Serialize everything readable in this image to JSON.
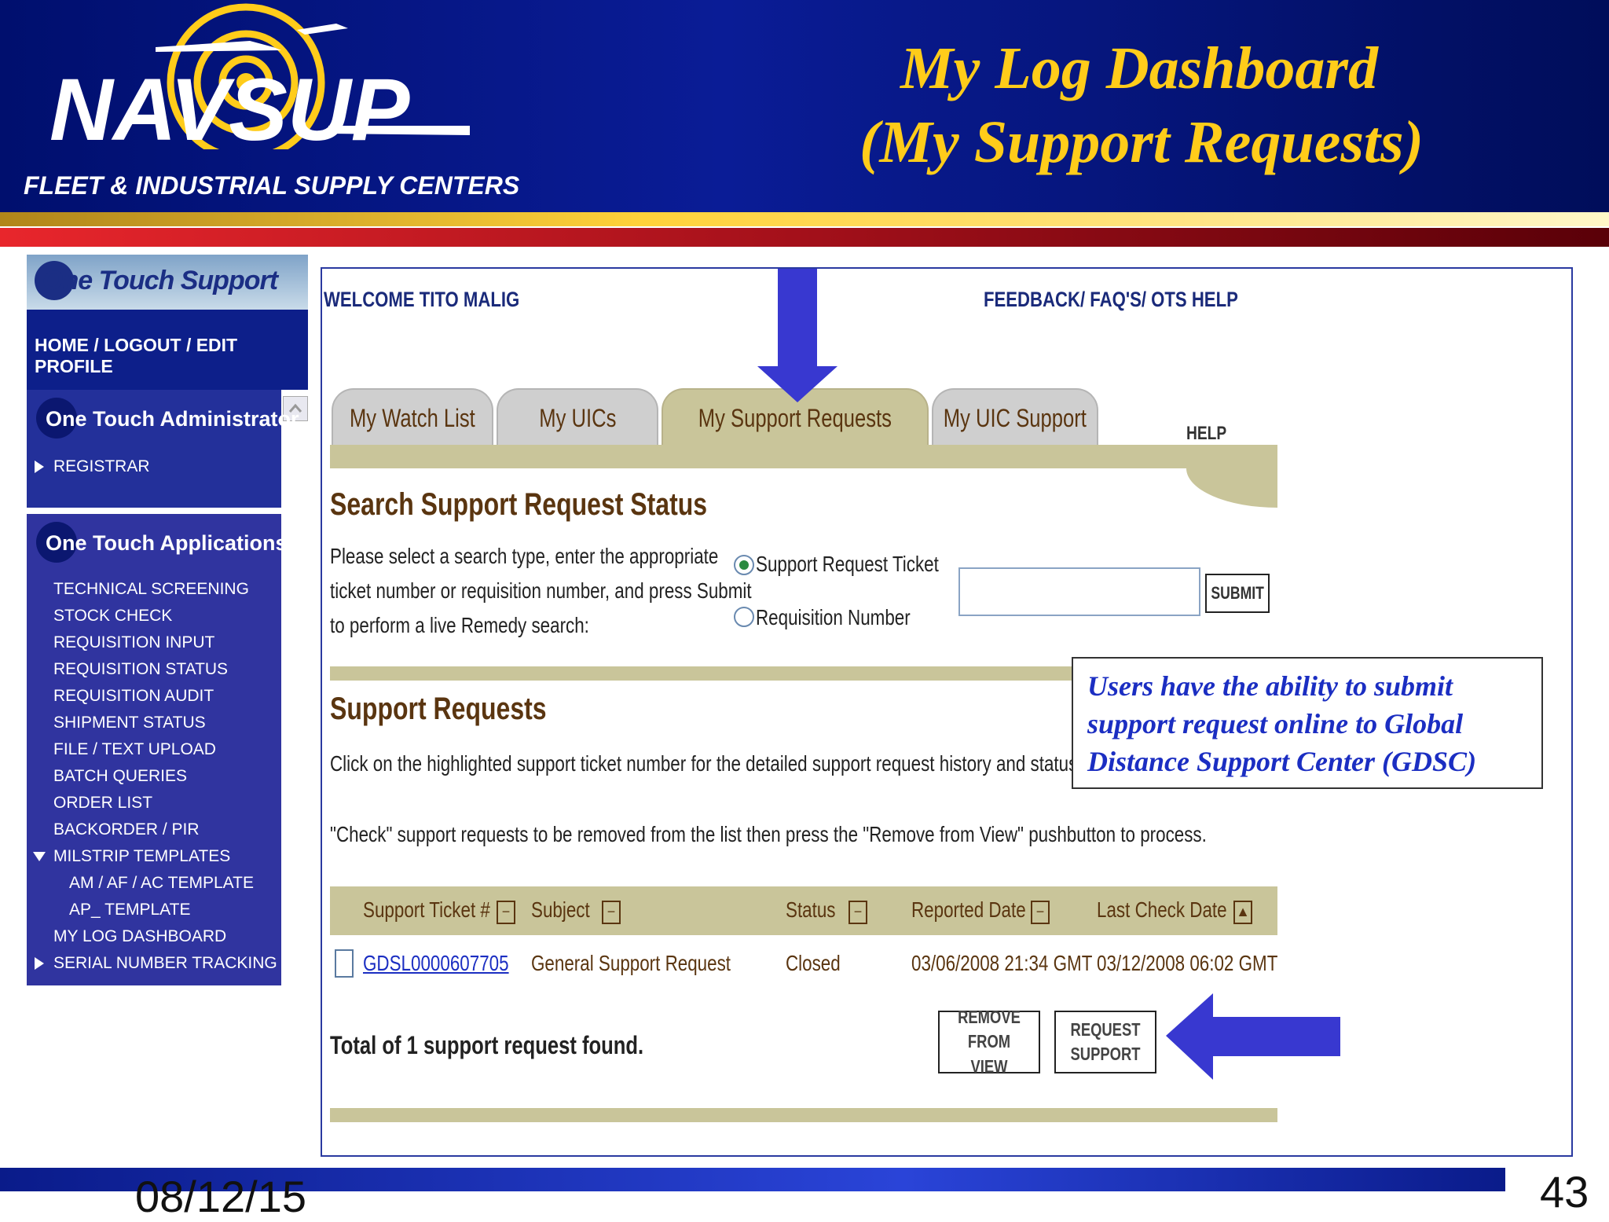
{
  "header": {
    "logo_text": "NAVSUP",
    "subtitle": "FLEET & INDUSTRIAL SUPPLY CENTERS",
    "title_line1": "My Log Dashboard",
    "title_line2": "(My Support Requests)"
  },
  "sidebar": {
    "brand": "One Touch Support",
    "top_links": "HOME / LOGOUT / EDIT PROFILE",
    "admin_heading": "One Touch Administrator",
    "admin_items": [
      "REGISTRAR"
    ],
    "apps_heading": "One Touch Applications",
    "apps_items": [
      "TECHNICAL SCREENING",
      "STOCK CHECK",
      "REQUISITION INPUT",
      "REQUISITION STATUS",
      "REQUISITION AUDIT",
      "SHIPMENT STATUS",
      "FILE / TEXT UPLOAD",
      "BATCH QUERIES",
      "ORDER LIST",
      "BACKORDER / PIR",
      "MILSTRIP TEMPLATES",
      "AM / AF / AC TEMPLATE",
      "AP_ TEMPLATE",
      "MY LOG DASHBOARD",
      "SERIAL NUMBER TRACKING"
    ]
  },
  "main": {
    "welcome": "WELCOME TITO MALIG",
    "feedback_links": "FEEDBACK/ FAQ'S/ OTS HELP",
    "tabs": [
      {
        "label": "My Watch List",
        "active": false
      },
      {
        "label": "My UICs",
        "active": false
      },
      {
        "label": "My Support Requests",
        "active": true
      },
      {
        "label": "My UIC Support",
        "active": false
      }
    ],
    "help_label": "HELP",
    "search": {
      "heading": "Search Support Request Status",
      "instructions": [
        "Please select a search type, enter the appropriate",
        "ticket number or requisition number, and press Submit",
        "to perform a live Remedy search:"
      ],
      "options": [
        {
          "label": "Support Request Ticket",
          "selected": true
        },
        {
          "label": "Requisition Number",
          "selected": false
        }
      ],
      "input_value": "",
      "submit_label": "SUBMIT"
    },
    "requests": {
      "heading": "Support Requests",
      "note1": "Click on the highlighted support ticket number for the detailed support request history and status.",
      "note2": "\"Check\" support requests to be removed from the list then press the \"Remove from View\" pushbutton to process.",
      "columns": [
        "Support Ticket #",
        "Subject",
        "Status",
        "Reported Date",
        "Last Check Date"
      ],
      "column_sort_symbols": [
        "−",
        "−",
        "−",
        "−",
        "▲"
      ],
      "rows": [
        {
          "ticket": "GDSL0000607705",
          "subject": "General Support Request",
          "status": "Closed",
          "reported": "03/06/2008 21:34 GMT",
          "last_check": "03/12/2008 06:02 GMT"
        }
      ],
      "total": "Total of 1 support request found.",
      "remove_label": "REMOVE FROM VIEW",
      "request_label": "REQUEST SUPPORT"
    },
    "callout": [
      "Users have the ability to submit",
      "support request online to Global",
      "Distance Support Center (GDSC)"
    ]
  },
  "footer": {
    "date": "08/12/15",
    "slide_number": "43"
  },
  "colors": {
    "banner": "#0a1c96",
    "title_gold": "#ffcc1a",
    "tab_khaki": "#c9c59a",
    "arrow_blue": "#3838d0",
    "callout_blue": "#1b2ec2"
  }
}
